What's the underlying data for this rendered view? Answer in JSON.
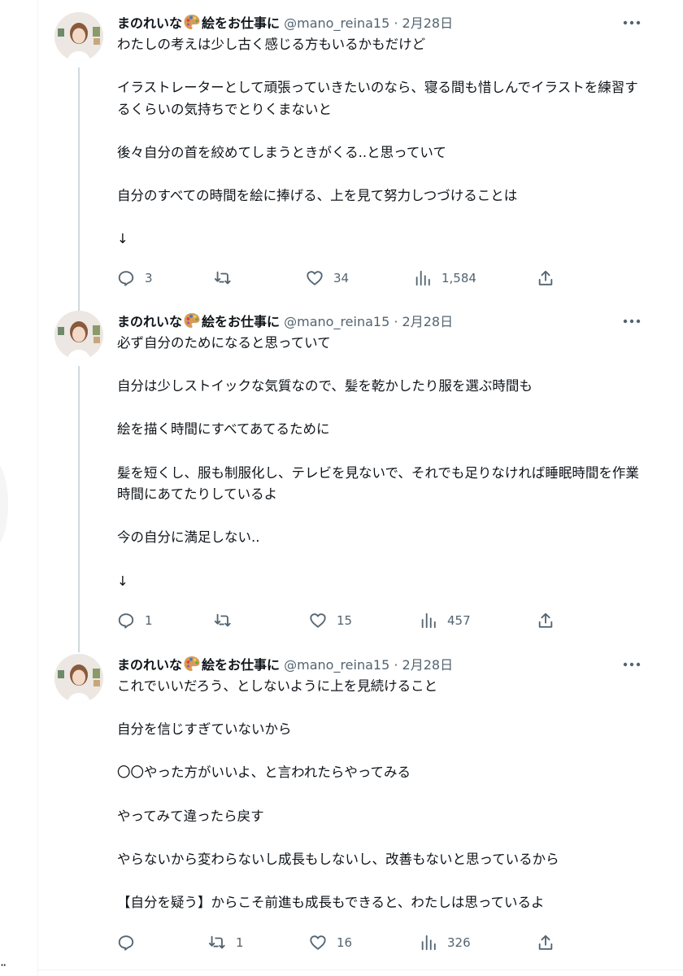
{
  "author": {
    "name": "まのれいな",
    "name_suffix": "絵をお仕事に",
    "handle": "@mano_reina15",
    "date": "2月28日"
  },
  "left_dots": "··",
  "tweets": [
    {
      "text": "わたしの考えは少し古く感じる方もいるかもだけど\n\nイラストレーターとして頑張っていきたいのなら、寝る間も惜しんでイラストを練習するくらいの気持ちでとりくまないと\n\n後々自分の首を絞めてしまうときがくる..と思っていて\n\n自分のすべての時間を絵に捧げる、上を見て努力しつづけることは\n\n↓",
      "replies": "3",
      "retweets": "",
      "likes": "34",
      "views": "1,584"
    },
    {
      "text": "必ず自分のためになると思っていて\n\n自分は少しストイックな気質なので、髪を乾かしたり服を選ぶ時間も\n\n絵を描く時間にすべてあてるために\n\n髪を短くし、服も制服化し、テレビを見ないで、それでも足りなければ睡眠時間を作業時間にあてたりしているよ\n\n今の自分に満足しない..\n\n↓",
      "replies": "1",
      "retweets": "",
      "likes": "15",
      "views": "457"
    },
    {
      "text": "これでいいだろう、としないように上を見続けること\n\n自分を信じすぎていないから\n\n〇〇やった方がいいよ、と言われたらやってみる\n\nやってみて違ったら戻す\n\nやらないから変わらないし成長もしないし、改善もないと思っているから\n\n【自分を疑う】からこそ前進も成長もできると、わたしは思っているよ",
      "replies": "",
      "retweets": "1",
      "likes": "16",
      "views": "326"
    }
  ],
  "icons": {
    "more": "more-icon",
    "reply": "reply-icon",
    "retweet": "retweet-icon",
    "like": "heart-icon",
    "views": "analytics-icon",
    "share": "share-icon"
  },
  "colors": {
    "text": "#0f1419",
    "secondary": "#536471",
    "thread_line": "#cfd9de"
  }
}
